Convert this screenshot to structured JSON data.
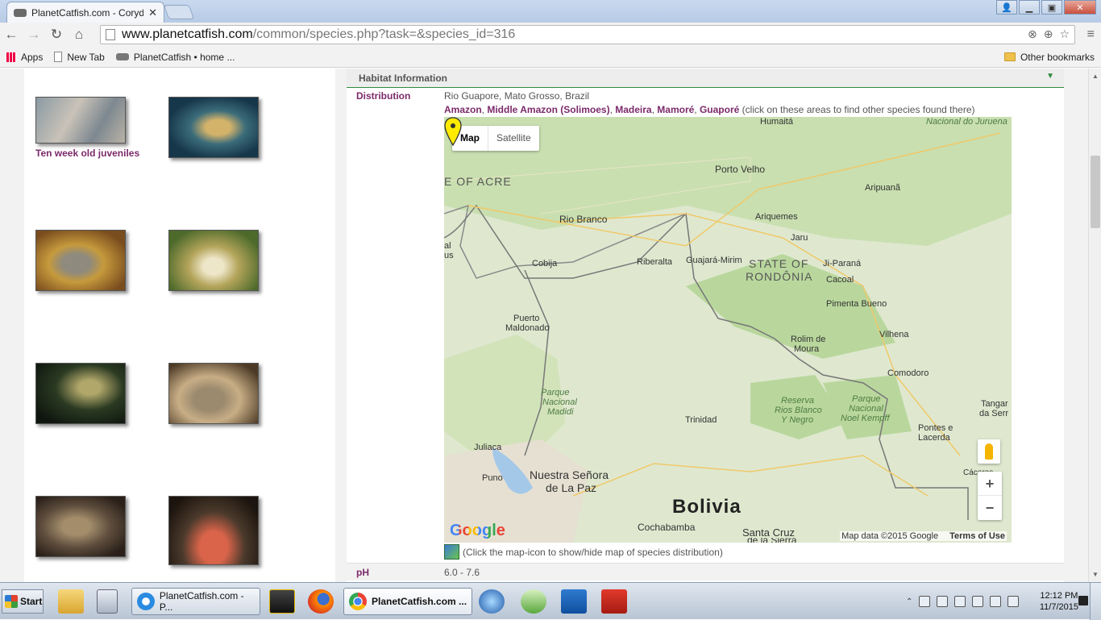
{
  "browser": {
    "tab_title": "PlanetCatfish.com - Corydoras",
    "url_host": "www.planetcatfish.com",
    "url_path": "/common/species.php?task=&species_id=316",
    "bookmarks": {
      "apps": "Apps",
      "new_tab": "New Tab",
      "planetcatfish": "PlanetCatfish • home ...",
      "other": "Other bookmarks"
    }
  },
  "gallery": {
    "caption": "Ten week old juveniles"
  },
  "habitat": {
    "section_title": "Habitat Information",
    "distribution_label": "Distribution",
    "distribution_value": "Rio Guapore, Mato Grosso, Brazil",
    "areas": {
      "a1": "Amazon",
      "a2": "Middle Amazon (Solimoes)",
      "a3": "Madeira",
      "a4": "Mamoré",
      "a5": "Guaporé",
      "sep": ", ",
      "hint": "(click on these areas to find other species found there)"
    },
    "map": {
      "map_btn": "Map",
      "satellite_btn": "Satellite",
      "labels": {
        "humaita": "Humaitá",
        "juruena": "Nacional do Juruena",
        "acre": "E OF ACRE",
        "porto_velho": "Porto Velho",
        "aripuana": "Aripuanã",
        "rio_branco": "Rio Branco",
        "ariquemes": "Ariquemes",
        "jaru": "Jaru",
        "al": "al",
        "us": "us",
        "cobija": "Cobija",
        "riberalta": "Riberalta",
        "guajara": "Guajará-Mirim",
        "state_of": "STATE OF",
        "rondonia": "RONDÔNIA",
        "ji_parana": "Ji-Paraná",
        "cacoal": "Cacoal",
        "pimenta": "Pimenta Bueno",
        "puerto": "Puerto",
        "maldonado": "Maldonado",
        "rolim": "Rolim de",
        "moura": "Moura",
        "vilhena": "Vilhena",
        "comodoro": "Comodoro",
        "parque_madidi": "Parque",
        "nacional_madidi": "Nacional",
        "madidi": "Madidi",
        "reserva": "Reserva",
        "rios_blanco": "Rios Blanco",
        "y_negro": "Y Negro",
        "parque_nk": "Parque",
        "nacional_nk": "Nacional",
        "noel": "Noel Kempff",
        "tangar": "Tangar",
        "da_serr": "da Serr",
        "trinidad": "Trinidad",
        "pontes": "Pontes e",
        "lacerda": "Lacerda",
        "juliaca": "Juliaca",
        "puno": "Puno",
        "la_paz_1": "Nuestra Señora",
        "la_paz_2": "de La Paz",
        "caceres": "Cáceres",
        "bolivia": "Bolivia",
        "cochabamba": "Cochabamba",
        "santa_cruz": "Santa Cruz",
        "de_la_sierra": "de la Sierra"
      },
      "zoom_in": "+",
      "zoom_out": "−",
      "google": "Google",
      "map_data": "Map data ©2015 Google",
      "terms": "Terms of Use",
      "icon_hint": "(Click the map-icon to show/hide map of species distribution)"
    },
    "ph_label": "pH",
    "ph_value": "6.0 - 7.6"
  },
  "taskbar": {
    "start": "Start",
    "ie_task": "PlanetCatfish.com - P...",
    "chrome_task": "PlanetCatfish.com ...",
    "time": "12:12 PM",
    "date": "11/7/2015"
  }
}
